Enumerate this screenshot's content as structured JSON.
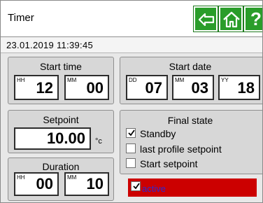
{
  "header": {
    "title": "Timer",
    "datetime": "23.01.2019 11:39:45",
    "nav": {
      "back_icon": "arrow-left-icon",
      "home_icon": "home-icon",
      "help_label": "?"
    },
    "accent_color": "#2a9d2a"
  },
  "start_time": {
    "label": "Start time",
    "hour": {
      "unit": "HH",
      "value": "12"
    },
    "minute": {
      "unit": "MM",
      "value": "00"
    }
  },
  "start_date": {
    "label": "Start date",
    "day": {
      "unit": "DD",
      "value": "07"
    },
    "month": {
      "unit": "MM",
      "value": "03"
    },
    "year": {
      "unit": "YY",
      "value": "18"
    }
  },
  "setpoint": {
    "label": "Setpoint",
    "value": "10.00",
    "unit": "°c"
  },
  "duration": {
    "label": "Duration",
    "hour": {
      "unit": "HH",
      "value": "00"
    },
    "minute": {
      "unit": "MM",
      "value": "10"
    }
  },
  "final_state": {
    "label": "Final state",
    "options": [
      {
        "label": "Standby",
        "checked": true
      },
      {
        "label": "last profile setpoint",
        "checked": false
      },
      {
        "label": "Start setpoint",
        "checked": false
      }
    ]
  },
  "active": {
    "label": "active",
    "checked": true,
    "bar_color": "#cc0000"
  }
}
